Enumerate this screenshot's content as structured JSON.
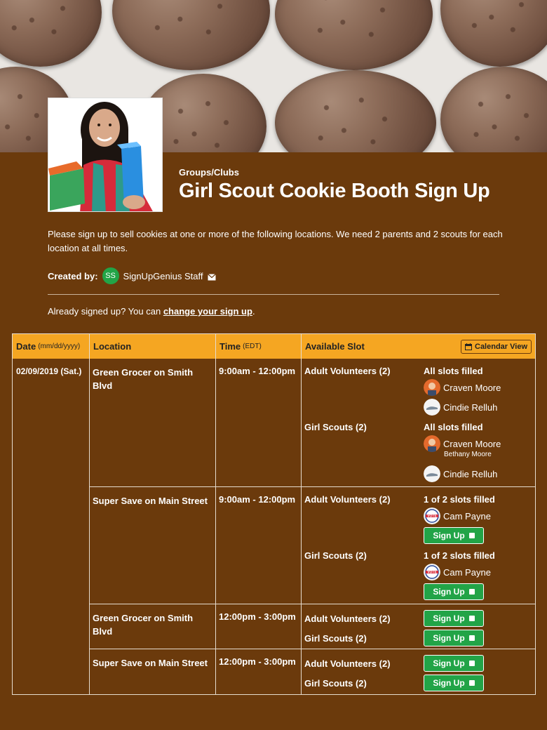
{
  "header": {
    "category": "Groups/Clubs",
    "title": "Girl Scout Cookie Booth Sign Up"
  },
  "description": "Please sign up to sell cookies at one or more of the following locations.  We need 2 parents and 2 scouts for each location at all times.",
  "creator": {
    "label": "Created by:",
    "initials": "SS",
    "name": "SignUpGenius Staff",
    "icon": "mail-icon"
  },
  "already": {
    "text": "Already signed up? You can ",
    "link": "change your sign up",
    "suffix": "."
  },
  "table": {
    "headers": {
      "date": "Date",
      "date_hint": "(mm/dd/yyyy)",
      "location": "Location",
      "time": "Time",
      "time_hint": "(EDT)",
      "slot": "Available Slot",
      "calendar_button": "Calendar View"
    },
    "date": "02/09/2019 (Sat.)",
    "signup_label": "Sign Up",
    "rows": [
      {
        "location": "Green Grocer on Smith Blvd",
        "time": "9:00am - 12:00pm",
        "slots": [
          {
            "name": "Adult Volunteers (2)",
            "status": "All slots filled",
            "people": [
              {
                "name": "Craven Moore",
                "avatar": "man-avatar"
              },
              {
                "name": "Cindie Relluh",
                "avatar": "shoe-avatar"
              }
            ]
          },
          {
            "name": "Girl Scouts (2)",
            "status": "All slots filled",
            "people": [
              {
                "name": "Craven Moore",
                "sub": "Bethany Moore",
                "avatar": "man-avatar"
              },
              {
                "name": "Cindie Relluh",
                "avatar": "shoe-avatar"
              }
            ]
          }
        ]
      },
      {
        "location": "Super Save on Main Street",
        "time": "9:00am - 12:00pm",
        "slots": [
          {
            "name": "Adult Volunteers (2)",
            "status": "1 of 2 slots filled",
            "people": [
              {
                "name": "Cam Payne",
                "avatar": "vote-avatar"
              }
            ]
          },
          {
            "name": "Girl Scouts (2)",
            "status": "1 of 2 slots filled",
            "people": [
              {
                "name": "Cam Payne",
                "avatar": "vote-avatar"
              }
            ]
          }
        ]
      },
      {
        "location": "Green Grocer on Smith Blvd",
        "time": "12:00pm - 3:00pm",
        "slots": [
          {
            "name": "Adult Volunteers (2)"
          },
          {
            "name": "Girl Scouts (2)"
          }
        ]
      },
      {
        "location": "Super Save on Main Street",
        "time": "12:00pm - 3:00pm",
        "slots": [
          {
            "name": "Adult Volunteers (2)"
          },
          {
            "name": "Girl Scouts (2)"
          }
        ]
      }
    ]
  },
  "colors": {
    "background": "#6b3a0c",
    "header": "#f5a622",
    "signup": "#22a447"
  }
}
